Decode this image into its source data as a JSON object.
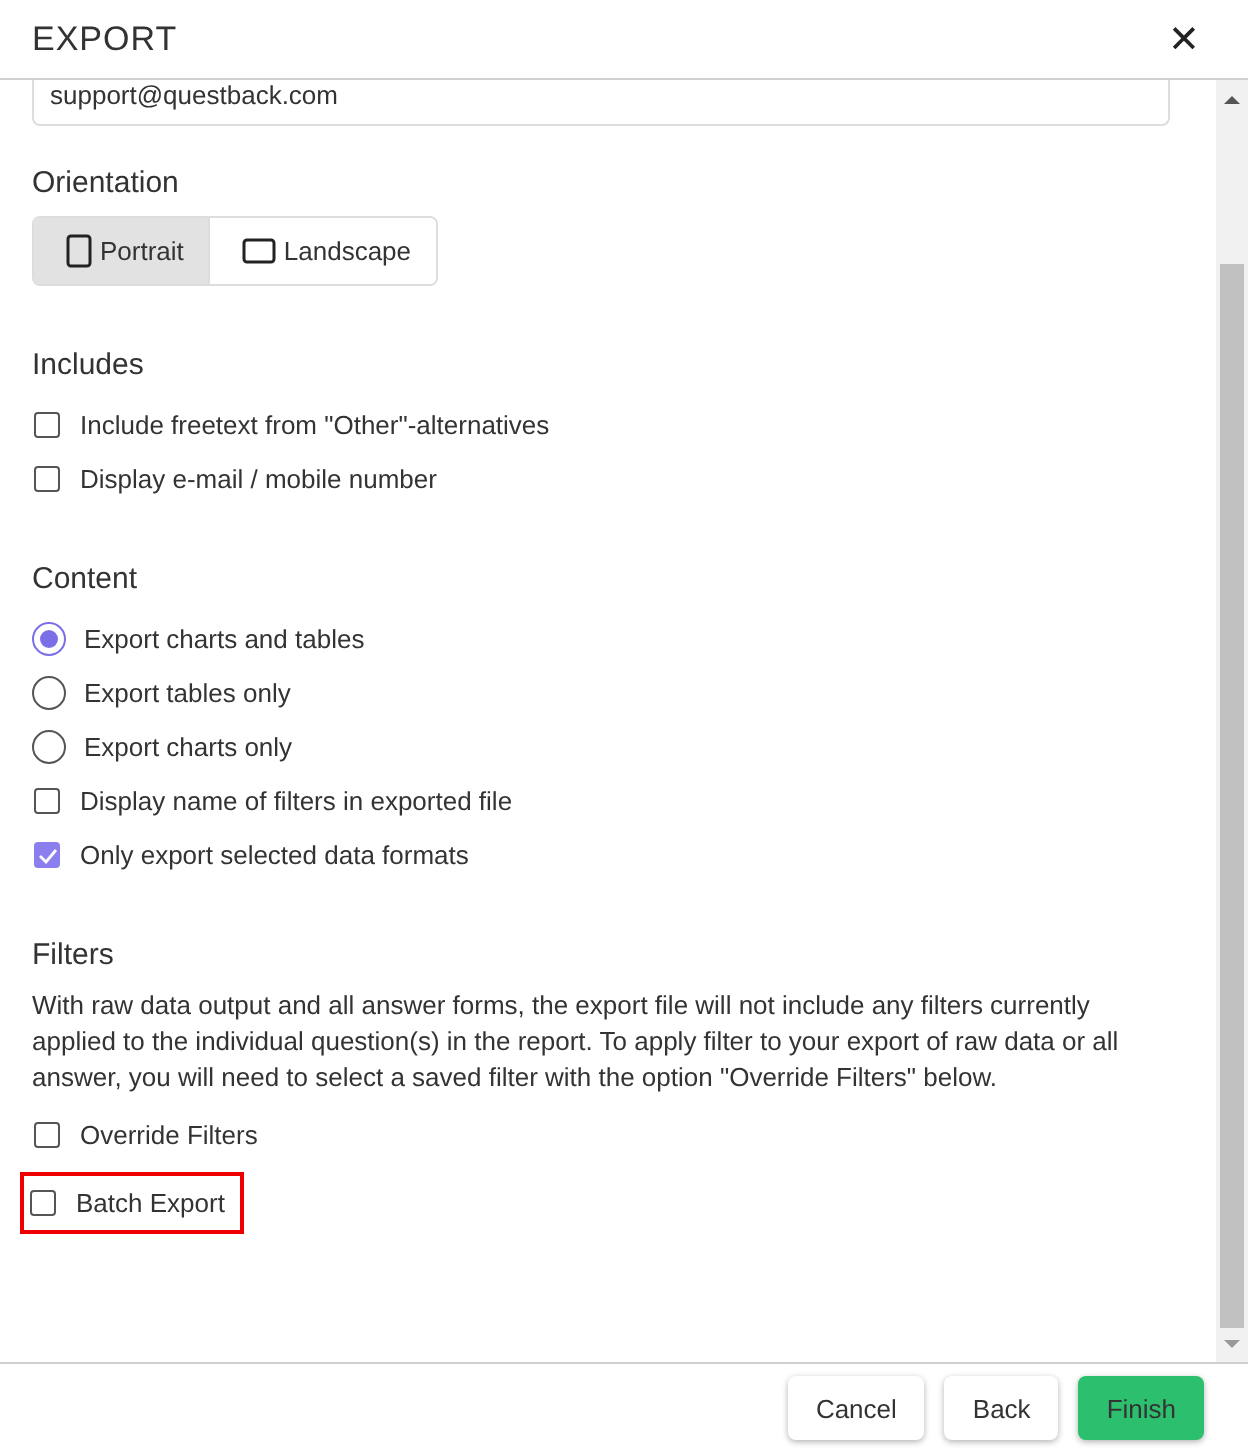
{
  "window": {
    "title": "EXPORT",
    "close": "✕"
  },
  "email_field": {
    "value": "support@questback.com"
  },
  "orientation": {
    "label": "Orientation",
    "options": [
      {
        "label": "Portrait",
        "selected": true
      },
      {
        "label": "Landscape",
        "selected": false
      }
    ]
  },
  "sections": [
    {
      "title": "Includes",
      "items": [
        {
          "kind": "checkbox",
          "label": "Include freetext from \"Other\"-alternatives",
          "checked": false,
          "highlighted": false
        },
        {
          "kind": "checkbox",
          "label": "Display e-mail / mobile number",
          "checked": false,
          "highlighted": false
        }
      ]
    },
    {
      "title": "Content",
      "items": [
        {
          "kind": "radio",
          "label": "Export charts and tables",
          "checked": true,
          "highlighted": false
        },
        {
          "kind": "radio",
          "label": "Export tables only",
          "checked": false,
          "highlighted": false
        },
        {
          "kind": "radio",
          "label": "Export charts only",
          "checked": false,
          "highlighted": false
        },
        {
          "kind": "checkbox",
          "label": "Display name of filters in exported file",
          "checked": false,
          "highlighted": false
        },
        {
          "kind": "checkbox",
          "label": "Only export selected data formats",
          "checked": true,
          "highlighted": false
        }
      ]
    },
    {
      "title": "Filters",
      "note": "With raw data output and all answer forms, the export file will not include any filters currently applied to the individual question(s) in the report. To apply filter to your export of raw data or all answer, you will need to select a saved filter with the option \"Override Filters\" below.",
      "items": [
        {
          "kind": "checkbox",
          "label": "Override Filters",
          "checked": false,
          "highlighted": false
        },
        {
          "kind": "checkbox",
          "label": "Batch Export",
          "checked": false,
          "highlighted": true
        }
      ]
    }
  ],
  "buttons": [
    {
      "label": "Cancel",
      "kind": "secondary"
    },
    {
      "label": "Back",
      "kind": "secondary"
    },
    {
      "label": "Finish",
      "kind": "primary"
    }
  ]
}
